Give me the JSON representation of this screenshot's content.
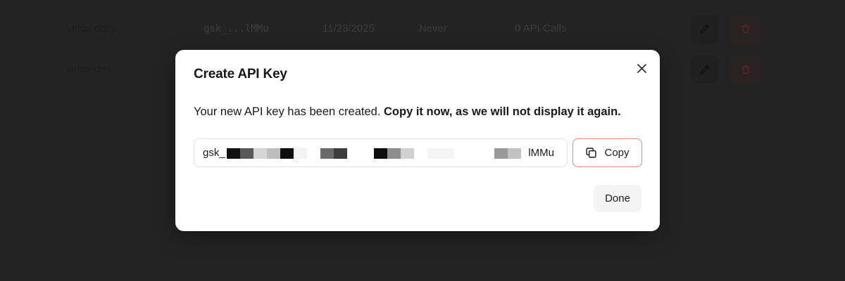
{
  "table": {
    "rows": [
      {
        "name": "velox-daily",
        "key": "gsk_...lMMu",
        "created": "11/23/2025",
        "last_used": "Never",
        "usage": "0 API Calls"
      },
      {
        "name": "velox-dev",
        "key": "",
        "created": "",
        "last_used": "",
        "usage": ""
      }
    ]
  },
  "modal": {
    "title": "Create API Key",
    "message_plain": "Your new API key has been created. ",
    "message_bold": "Copy it now, as we will not display it again.",
    "key_prefix": "gsk_",
    "key_suffix": "lMMu",
    "copy_label": "Copy",
    "done_label": "Done"
  },
  "icons": {
    "close": "close-icon",
    "copy": "copy-icon",
    "edit": "pencil-icon",
    "delete": "trash-icon"
  },
  "colors": {
    "overlay": "#232323",
    "copy_border": "#e4877d",
    "delete_icon": "#5a2525"
  }
}
